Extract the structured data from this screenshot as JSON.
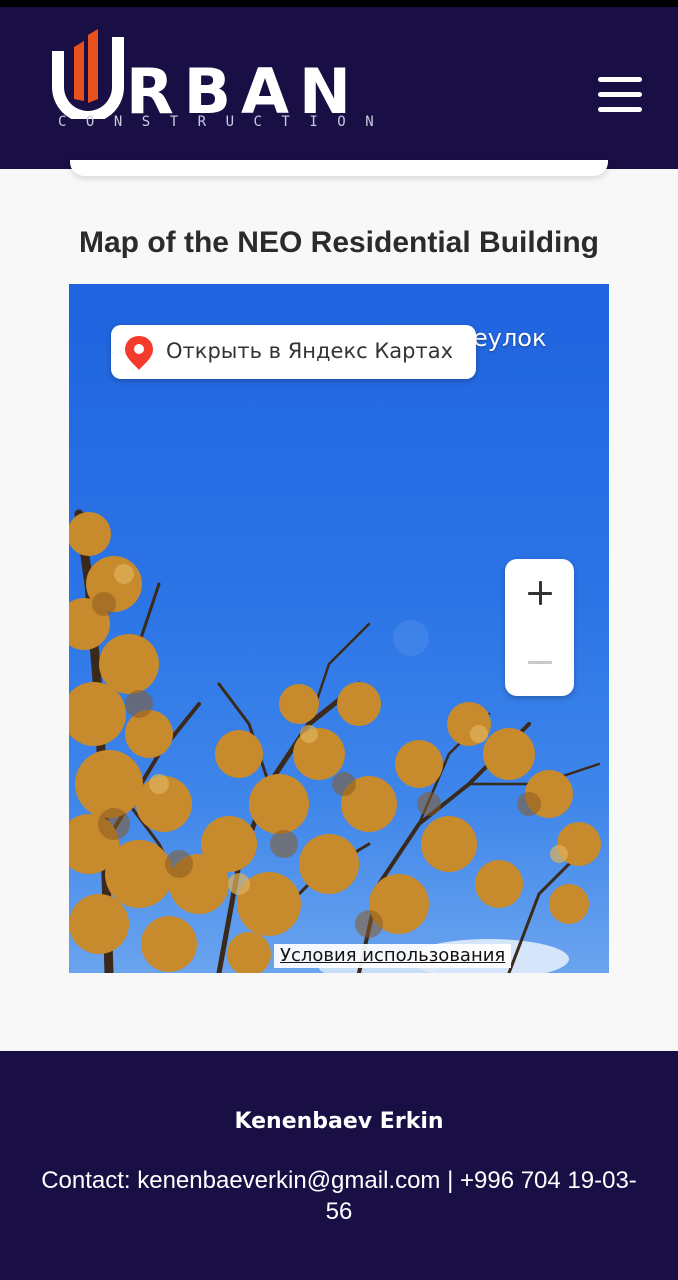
{
  "header": {
    "logo_word": "RBAN",
    "logo_subtitle": "CONSTRUCTION",
    "logo_alt": "Urban Construction",
    "menu_icon": "hamburger-menu-icon"
  },
  "main": {
    "title": "Map of the NEO Residential Building"
  },
  "map": {
    "street_label": "еулок",
    "open_button_label": "Открыть в Яндекс Картах",
    "open_button_icon": "map-pin-icon",
    "zoom_in_icon": "plus-icon",
    "zoom_out_icon": "minus-icon",
    "terms_link": "Условия использования"
  },
  "footer": {
    "name": "Kenenbaev Erkin",
    "contact": "Contact: kenenbaeverkin@gmail.com | +996 704 19-03-56"
  },
  "colors": {
    "navy": "#1a0f45",
    "logo_orange": "#e8501c",
    "sky_blue": "#2b74e6",
    "pin_red": "#f43b2b"
  }
}
